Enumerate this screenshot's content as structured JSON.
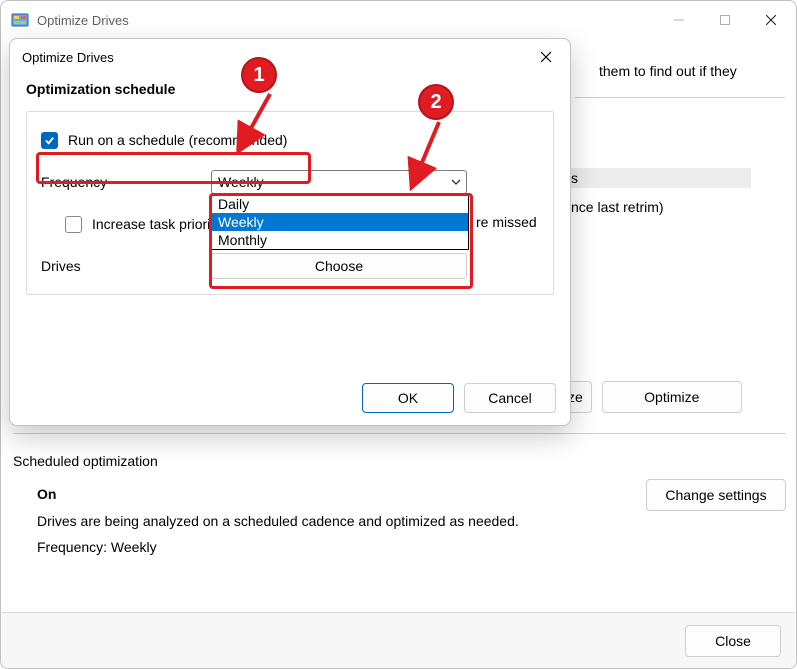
{
  "parent": {
    "title": "Optimize Drives",
    "intro_fragment": "them to find out if they",
    "status_fragment_1": "s",
    "status_fragment_2": "nce last retrim)",
    "analyze_label": "ze",
    "optimize_label": "Optimize",
    "scheduled_heading": "Scheduled optimization",
    "scheduled_on": "On",
    "scheduled_desc": "Drives are being analyzed on a scheduled cadence and optimized as needed.",
    "scheduled_freq": "Frequency: Weekly",
    "change_settings_label": "Change settings",
    "close_label": "Close"
  },
  "dialog": {
    "title": "Optimize Drives",
    "heading": "Optimization schedule",
    "run_schedule_label": "Run on a schedule (recommended)",
    "frequency_label": "Frequency",
    "frequency_value": "Weekly",
    "dropdown": {
      "opt0": "Daily",
      "opt1": "Weekly",
      "opt2": "Monthly"
    },
    "increase_priority_fragment": "Increase task priori",
    "missed_fragment": "re missed",
    "drives_label": "Drives",
    "choose_label": "Choose",
    "ok_label": "OK",
    "cancel_label": "Cancel"
  },
  "annotations": {
    "n1": "1",
    "n2": "2"
  }
}
